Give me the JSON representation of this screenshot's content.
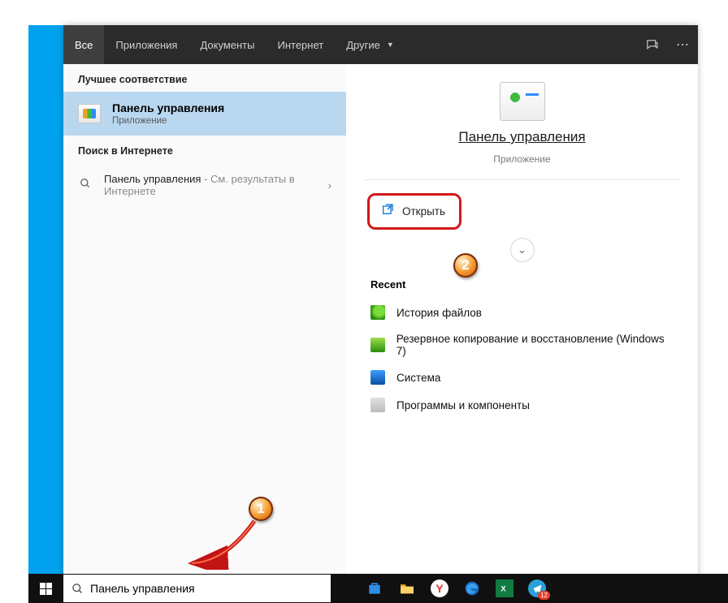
{
  "tabs": {
    "all": "Все",
    "apps": "Приложения",
    "docs": "Документы",
    "internet": "Интернет",
    "other": "Другие"
  },
  "left": {
    "best_header": "Лучшее соответствие",
    "best_title": "Панель управления",
    "best_sub": "Приложение",
    "web_header": "Поиск в Интернете",
    "web_prefix": "Панель управления",
    "web_suffix": " - См. результаты в Интернете"
  },
  "right": {
    "title": "Панель управления",
    "sub": "Приложение",
    "open": "Открыть",
    "recent_header": "Recent",
    "recent": [
      "История файлов",
      "Резервное копирование и восстановление (Windows 7)",
      "Система",
      "Программы и компоненты"
    ]
  },
  "search_value": "Панель управления",
  "telegram_badge": "12",
  "steps": {
    "one": "1",
    "two": "2"
  }
}
